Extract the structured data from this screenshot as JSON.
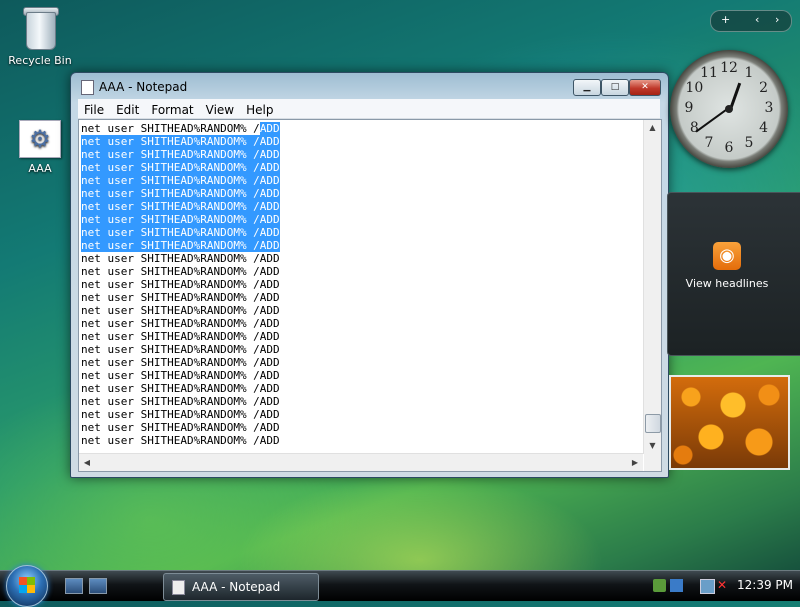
{
  "desktop": {
    "icons": [
      {
        "label": "Recycle Bin",
        "icon": "recycle-bin-icon"
      },
      {
        "label": "AAA",
        "icon": "batch-file-gear-icon"
      }
    ]
  },
  "notepad": {
    "title": "AAA - Notepad",
    "menu": [
      "File",
      "Edit",
      "Format",
      "View",
      "Help"
    ],
    "line_text": "net user SHITHEAD%RANDOM% /ADD",
    "line_prefix": "net user SHITHEAD%RANDOM% /",
    "line_suffix": "ADD",
    "line_count": 25,
    "selected_lines": [
      1,
      2,
      3,
      4,
      5,
      6,
      7,
      8,
      9
    ],
    "selection_color": "#3399ff"
  },
  "gadgets": {
    "controls": {
      "add": "+",
      "prev": "‹",
      "next": "›"
    },
    "clock_numbers": [
      "12",
      "1",
      "2",
      "3",
      "4",
      "5",
      "6",
      "7",
      "8",
      "9",
      "10",
      "11"
    ],
    "clock_time": {
      "hour": 12,
      "minute": 39
    },
    "headlines_label": "View headlines",
    "headlines_icon": "rss-feed-icon",
    "slideshow_icon": "orange-flowers-photo"
  },
  "taskbar": {
    "task_label": "AAA - Notepad",
    "clock": "12:39 PM",
    "tray_icons": [
      "network-icon",
      "windows-defender-icon",
      "display-icon",
      "volume-muted-icon"
    ]
  }
}
